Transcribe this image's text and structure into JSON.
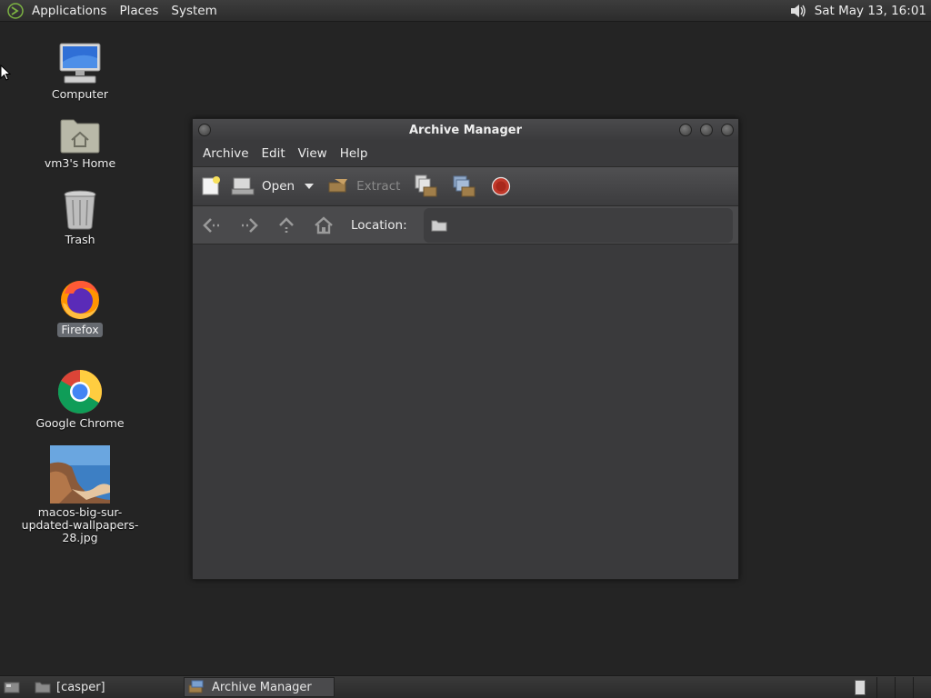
{
  "top_panel": {
    "menus": [
      "Applications",
      "Places",
      "System"
    ],
    "clock": "Sat May 13, 16:01"
  },
  "desktop": {
    "icons": [
      {
        "label": "Computer",
        "icon": "computer-icon"
      },
      {
        "label": "vm3's Home",
        "icon": "home-folder-icon"
      },
      {
        "label": "Trash",
        "icon": "trash-icon"
      },
      {
        "label": "Firefox",
        "icon": "firefox-icon",
        "selected": true
      },
      {
        "label": "Google Chrome",
        "icon": "chrome-icon"
      },
      {
        "label": "macos-big-sur-updated-wallpapers-28.jpg",
        "icon": "image-file-icon"
      }
    ]
  },
  "window": {
    "title": "Archive Manager",
    "menus": [
      "Archive",
      "Edit",
      "View",
      "Help"
    ],
    "toolbar": {
      "open_label": "Open",
      "extract_label": "Extract"
    },
    "location_label": "Location:"
  },
  "bottom_panel": {
    "tasks": [
      "[casper]",
      "Archive Manager"
    ]
  },
  "colors": {
    "desktop_bg": "#242424",
    "window_bg": "#3a3a3c",
    "stop_red": "#c0392b"
  }
}
